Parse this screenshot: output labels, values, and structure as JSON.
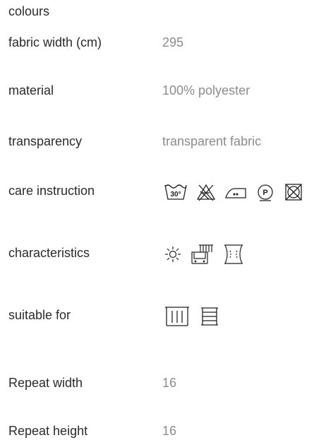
{
  "rows": {
    "colours": {
      "label": "colours"
    },
    "fabric_width": {
      "label": "fabric width (cm)",
      "value": "295"
    },
    "material": {
      "label": "material",
      "value": "100% polyester"
    },
    "transparency": {
      "label": "transparency",
      "value": "transparent fabric"
    },
    "care": {
      "label": "care instruction",
      "wash_temp": "30°",
      "dryclean_letter": "P",
      "icons": [
        "wash-30-icon",
        "no-bleach-icon",
        "iron-low-icon",
        "dry-clean-p-icon",
        "no-tumble-dry-icon"
      ]
    },
    "characteristics": {
      "label": "characteristics",
      "icons": [
        "light-fast-icon",
        "washable-curtain-icon",
        "flame-retardant-icon"
      ]
    },
    "suitable_for": {
      "label": "suitable for",
      "icons": [
        "curtain-icon",
        "roller-blind-icon"
      ]
    },
    "repeat_width": {
      "label": "Repeat width",
      "value": "16"
    },
    "repeat_height": {
      "label": "Repeat height",
      "value": "16"
    }
  },
  "colors": {
    "label": "#2b2b2b",
    "value": "#8c8c8c",
    "icon_stroke": "#222222"
  }
}
